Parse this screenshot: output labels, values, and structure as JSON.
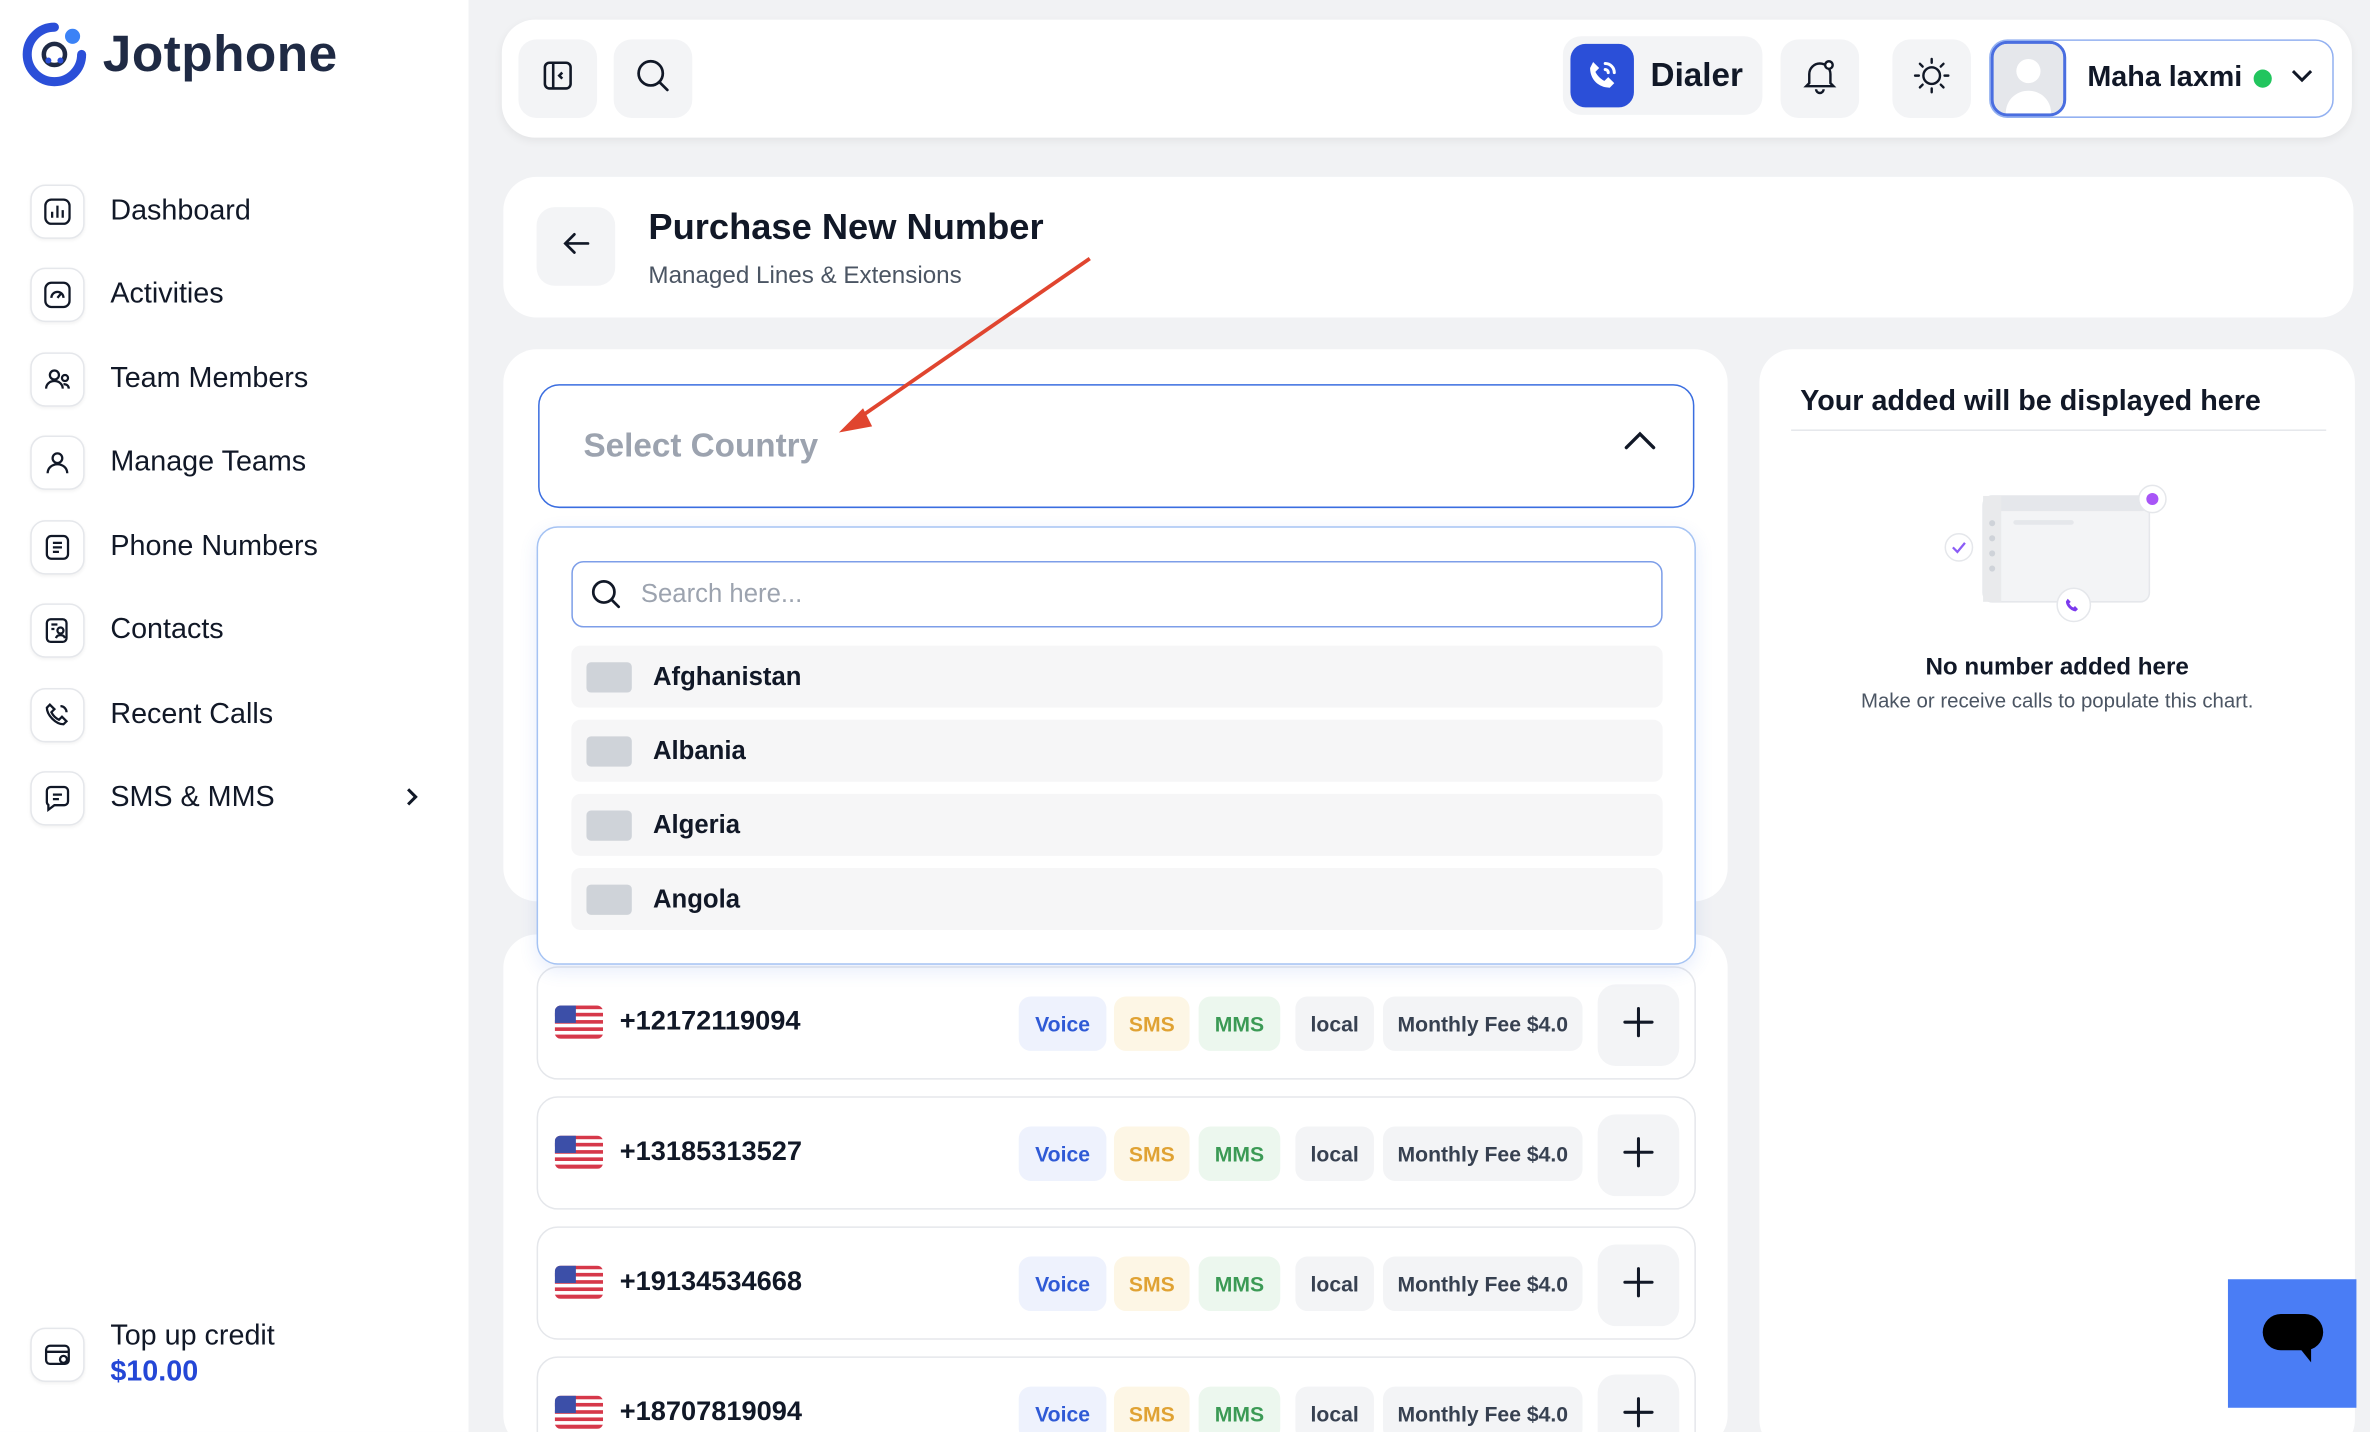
{
  "app": {
    "name": "Jotphone"
  },
  "sidebar": {
    "items": [
      {
        "label": "Dashboard",
        "icon": "chart-icon"
      },
      {
        "label": "Activities",
        "icon": "gauge-icon"
      },
      {
        "label": "Team Members",
        "icon": "team-icon"
      },
      {
        "label": "Manage Teams",
        "icon": "users-icon"
      },
      {
        "label": "Phone Numbers",
        "icon": "phonebook-icon"
      },
      {
        "label": "Contacts",
        "icon": "contacts-icon"
      },
      {
        "label": "Recent Calls",
        "icon": "phone-call-icon"
      },
      {
        "label": "SMS & MMS",
        "icon": "message-icon"
      }
    ],
    "topup": {
      "label": "Top up credit",
      "amount": "$10.00"
    }
  },
  "header": {
    "dialer_label": "Dialer",
    "user_name": "Maha laxmi",
    "status_color": "#22c55e"
  },
  "page": {
    "title": "Purchase New Number",
    "subtitle": "Managed Lines & Extensions"
  },
  "country_select": {
    "placeholder": "Select Country",
    "search_placeholder": "Search here...",
    "options": [
      "Afghanistan",
      "Albania",
      "Algeria",
      "Angola"
    ]
  },
  "numbers": [
    {
      "number": "+12172119094",
      "tags": [
        "Voice",
        "SMS",
        "MMS",
        "local"
      ],
      "fee": "Monthly Fee $4.0"
    },
    {
      "number": "+13185313527",
      "tags": [
        "Voice",
        "SMS",
        "MMS",
        "local"
      ],
      "fee": "Monthly Fee $4.0"
    },
    {
      "number": "+19134534668",
      "tags": [
        "Voice",
        "SMS",
        "MMS",
        "local"
      ],
      "fee": "Monthly Fee $4.0"
    },
    {
      "number": "+18707819094",
      "tags": [
        "Voice",
        "SMS",
        "MMS",
        "local"
      ],
      "fee": "Monthly Fee $4.0"
    }
  ],
  "right_panel": {
    "title": "Your added will be displayed here",
    "empty_title": "No number added here",
    "empty_subtitle": "Make or receive calls to populate this chart."
  },
  "colors": {
    "accent": "#2b4fd8",
    "voice": "#2f5ad6",
    "sms": "#e0a233",
    "mms": "#3b9a55",
    "arrow": "#e0452f",
    "chat": "#4a7df5"
  }
}
